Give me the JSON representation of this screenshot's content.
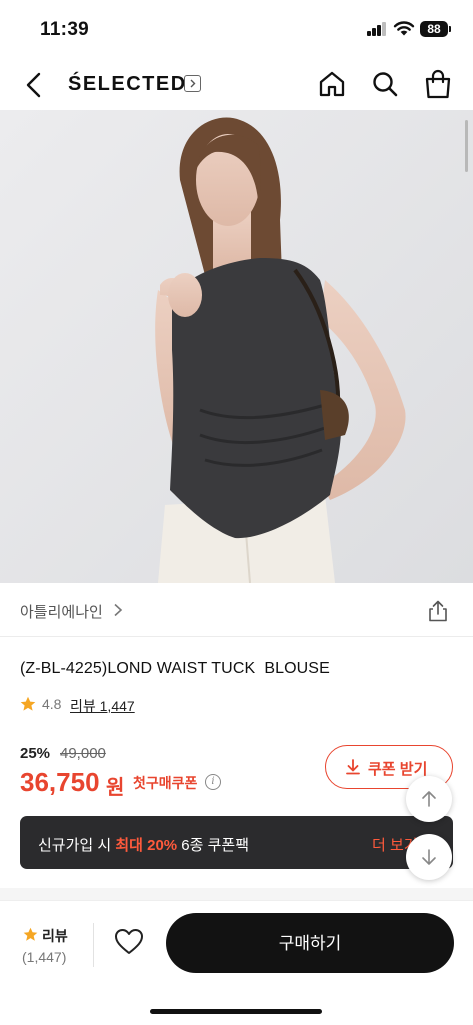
{
  "status_bar": {
    "time": "11:39",
    "battery": "88"
  },
  "nav": {
    "brand": "ŚELECTED",
    "icons": [
      "back-icon",
      "home-icon",
      "search-icon",
      "shopping-bag-icon"
    ]
  },
  "product": {
    "store": "아틀리에나인",
    "name": "(Z-BL-4225)LOND WAIST TUCK  BLOUSE",
    "rating": "4.8",
    "review_link": "리뷰 1,447",
    "discount": "25%",
    "original_price": "49,000",
    "sale_price": "36,750",
    "currency": "원",
    "first_coupon": "첫구매쿠폰",
    "info": "i"
  },
  "coupon_button": {
    "label": "쿠폰 받기"
  },
  "promo": {
    "text_before": "신규가입 시 ",
    "highlight": "최대 20%",
    "text_after": " 6종 쿠폰팩",
    "more": "더 보기"
  },
  "bottom_bar": {
    "review_label": "리뷰",
    "review_count": "(1,447)",
    "buy_label": "구매하기"
  },
  "colors": {
    "accent": "#e8452f",
    "dark": "#121212",
    "banner": "#2b2b2d",
    "star": "#f5a623"
  }
}
